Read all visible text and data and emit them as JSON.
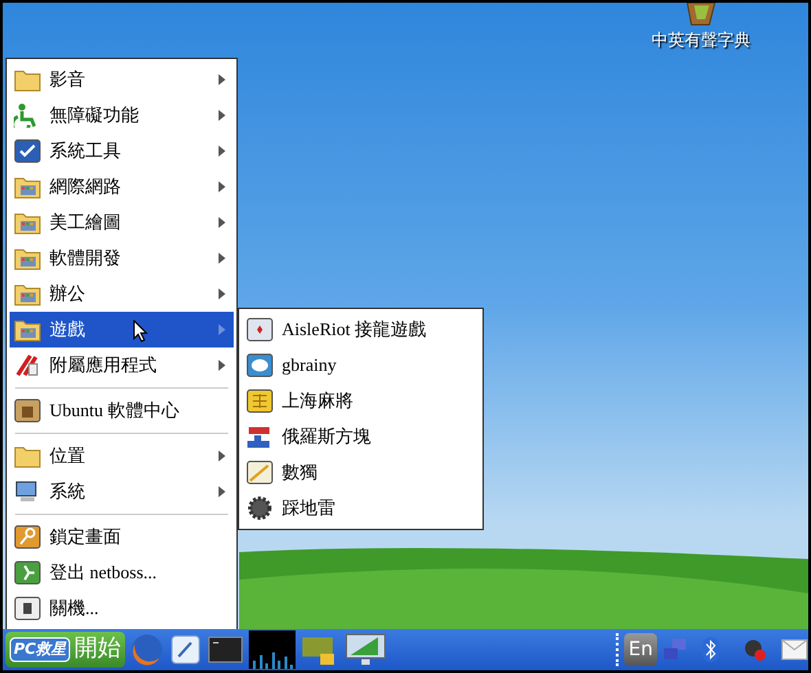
{
  "desktop": {
    "icons": [
      {
        "label": "中英有聲字典"
      }
    ]
  },
  "menu": {
    "groups": [
      {
        "items": [
          {
            "label": "影音",
            "has_submenu": true,
            "selected": false
          },
          {
            "label": "無障礙功能",
            "has_submenu": true,
            "selected": false
          },
          {
            "label": "系統工具",
            "has_submenu": true,
            "selected": false
          },
          {
            "label": "網際網路",
            "has_submenu": true,
            "selected": false
          },
          {
            "label": "美工繪圖",
            "has_submenu": true,
            "selected": false
          },
          {
            "label": "軟體開發",
            "has_submenu": true,
            "selected": false
          },
          {
            "label": "辦公",
            "has_submenu": true,
            "selected": false
          },
          {
            "label": "遊戲",
            "has_submenu": true,
            "selected": true
          },
          {
            "label": "附屬應用程式",
            "has_submenu": true,
            "selected": false
          }
        ]
      },
      {
        "items": [
          {
            "label": "Ubuntu 軟體中心",
            "has_submenu": false,
            "selected": false
          }
        ]
      },
      {
        "items": [
          {
            "label": "位置",
            "has_submenu": true,
            "selected": false
          },
          {
            "label": "系統",
            "has_submenu": true,
            "selected": false
          }
        ]
      },
      {
        "items": [
          {
            "label": "鎖定畫面",
            "has_submenu": false,
            "selected": false
          },
          {
            "label": "登出 netboss...",
            "has_submenu": false,
            "selected": false
          },
          {
            "label": "關機...",
            "has_submenu": false,
            "selected": false
          }
        ]
      }
    ]
  },
  "submenu": {
    "items": [
      {
        "label": "AisleRiot 接龍遊戲"
      },
      {
        "label": "gbrainy"
      },
      {
        "label": "上海麻將"
      },
      {
        "label": "俄羅斯方塊"
      },
      {
        "label": "數獨"
      },
      {
        "label": "踩地雷"
      }
    ]
  },
  "taskbar": {
    "start_button": {
      "logo": "PC救星",
      "label": "開始"
    },
    "tray": {
      "keyboard_indicator": "En"
    }
  }
}
